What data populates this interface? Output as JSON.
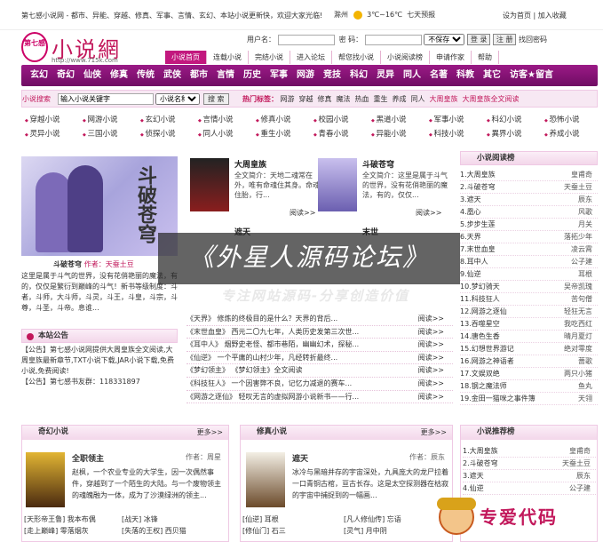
{
  "topbar": {
    "site_desc": "第七感小说网 - 都市、异能、穿越、修真、军事、言情、玄幻、本站小说更新快，欢迎大家光临!",
    "city": "滁州",
    "temp": "3℃~16℃",
    "forecast": "七天预报",
    "set_home": "设为首页",
    "add_fav": "加入收藏"
  },
  "logo": {
    "badge": "第七感",
    "name": "小说網",
    "url": "http://www.715k.com"
  },
  "login": {
    "user_label": "用户名：",
    "pass_label": "密 码：",
    "remember_select": "不保存",
    "login_btn": "登 录",
    "register_btn": "注 册",
    "find_pwd": "找回密码"
  },
  "subnav": [
    "小说首页",
    "连载小说",
    "完结小说",
    "进入论坛",
    "帮您找小说",
    "小说阅读榜",
    "申请作家",
    "帮助"
  ],
  "mainnav": [
    "玄幻",
    "奇幻",
    "仙侠",
    "修真",
    "传统",
    "武侠",
    "都市",
    "言情",
    "历史",
    "军事",
    "网游",
    "竞技",
    "科幻",
    "灵异",
    "同人",
    "名著",
    "科教",
    "其它",
    "访客★留言"
  ],
  "search": {
    "label": "小说搜索",
    "value": "输入小说关键字",
    "type": "小说名称",
    "btn": "搜 索",
    "hot_label": "热门标签：",
    "tags": [
      "网游",
      "穿越",
      "修真",
      "魔法",
      "热血",
      "重生",
      "养成",
      "同人",
      "大周皇族",
      "大周皇族全文阅读"
    ]
  },
  "categories": [
    [
      "穿越小说",
      "网游小说",
      "玄幻小说",
      "言情小说",
      "修真小说",
      "校园小说",
      "黑道小说",
      "军事小说",
      "科幻小说",
      "恐怖小说"
    ],
    [
      "灵异小说",
      "三国小说",
      "侦探小说",
      "同人小说",
      "重生小说",
      "青春小说",
      "异能小说",
      "科技小说",
      "異界小说",
      "养成小说"
    ]
  ],
  "featured": {
    "cover_title": "斗破苍穹",
    "cover_author": "作者：天蚕土豆",
    "title": "斗破苍穹",
    "author": "作者：天蚕土豆",
    "desc": "这里是属于斗气的世界，没有花俏艳丽的魔法，有的，仅仅是繁衍到巅峰的斗气！新书等级制度：斗者，斗师，大斗师，斗灵，斗王，斗皇，斗宗，斗尊，斗圣，斗帝。息谁..."
  },
  "notice": {
    "title": "本站公告",
    "lines": [
      "【公告】第七感小说网提供大周皇族全文阅读,大周皇族最新章节,TXT小说下载,JAR小说下载,免费小说,免费阅读!",
      "【公告】第七感书友群：118331897"
    ]
  },
  "mid_books": [
    {
      "title": "大周皇族",
      "desc": "全文简介：天地二魂常在外，唯有命魂住其身。命魂住胎，行...",
      "more": "阅读>>"
    },
    {
      "title": "斗破苍穹",
      "desc": "全文简介：这里是属于斗气的世界，没有花俏艳丽的魔法，有的，仅仅...",
      "more": "阅读>>"
    },
    {
      "title": "遮天",
      "desc": "",
      "more": ""
    },
    {
      "title": "末世",
      "desc": "",
      "more": ""
    }
  ],
  "mid_list": [
    {
      "t": "《天界》",
      "d": "修炼的终极目的是什么？天界的背后...",
      "r": "阅读>>"
    },
    {
      "t": "《末世血皇》",
      "d": "西元二〇九七年，人类历史发第三次世...",
      "r": "阅读>>"
    },
    {
      "t": "《耳中人》",
      "d": "烟野史老怪、都市巷陌，幽幽幻术，探秘...",
      "r": "阅读>>"
    },
    {
      "t": "《仙逆》",
      "d": "一个平庸的山村少年，凡经转折最终...",
      "r": "阅读>>"
    },
    {
      "t": "《梦幻领主》",
      "d": "《梦幻领主》全文阅读",
      "r": "阅读>>"
    },
    {
      "t": "《科技狂人》",
      "d": "一个因害弊不良，记忆力减退的赛车...",
      "r": "阅读>>"
    },
    {
      "t": "《网游之逐仙》",
      "d": "轻叹无言的虚拟网游小说新书——行...",
      "r": "阅读>>"
    }
  ],
  "rank": {
    "title": "小说阅读榜",
    "items": [
      {
        "n": "1.大周皇族",
        "a": "皇甫奇"
      },
      {
        "n": "2.斗破苍穹",
        "a": "天蚕土豆"
      },
      {
        "n": "3.遮天",
        "a": "辰东"
      },
      {
        "n": "4.凰心",
        "a": "风歌"
      },
      {
        "n": "5.步步生莲",
        "a": "月关"
      },
      {
        "n": "6.天界",
        "a": "落拓少年"
      },
      {
        "n": "7.末世血皇",
        "a": "凌云霄"
      },
      {
        "n": "8.耳中人",
        "a": "公子建"
      },
      {
        "n": "9.仙逆",
        "a": "耳根"
      },
      {
        "n": "10.梦幻骑天",
        "a": "吴帝凯瑰"
      },
      {
        "n": "11.科技狂人",
        "a": "苦句僧"
      },
      {
        "n": "12.网游之逐仙",
        "a": "轻狂无言"
      },
      {
        "n": "13.吞噬星空",
        "a": "我吃西红"
      },
      {
        "n": "14.唐色生香",
        "a": "晴月夏灯"
      },
      {
        "n": "15.幻想世界游记",
        "a": "绝对零度"
      },
      {
        "n": "16.网游之神语者",
        "a": "蔷歌"
      },
      {
        "n": "17.文娱双绝",
        "a": "两只小猪"
      },
      {
        "n": "18.钢之魔法师",
        "a": "鱼丸"
      },
      {
        "n": "19.金田一猫咪之事件簿",
        "a": "天翎"
      }
    ]
  },
  "watermark": {
    "main": "《外星人源码论坛》",
    "sub": "专注网站源码-分享创造价值"
  },
  "sections": [
    {
      "title": "奇幻小说",
      "more": "更多>>",
      "book": {
        "title": "全职领主",
        "author": "作者：周星",
        "desc": "赵枫，一个农业专业的大学生，因一次偶然事件，穿越到了一个陌生的大陆。与一个废物领主的魂魄融为一体，成为了沙漠绿洲的领主..."
      },
      "links": [
        "[天形帝王鲁] 我本布偶",
        "[战天] 冰锋",
        "[走上巅峰] 零落烟灰",
        "[失落的王权] 西贝猫"
      ]
    },
    {
      "title": "修真小说",
      "more": "更多>>",
      "book": {
        "title": "遮天",
        "author": "作者：辰东",
        "desc": "冰冷与黑暗并存的宇宙深处，九具庞大的龙尸拉着一口青铜古棺，亘古长存。这是太空探测器在枯寂的宇宙中捕捉到的一幅画..."
      },
      "links": [
        "[仙逆] 耳根",
        "[凡人修仙传] 忘语",
        "[修仙门] 石三",
        "[灵气] 月中阴"
      ]
    },
    {
      "title": "小说推荐榜",
      "more": "",
      "items": [
        "1.大周皇族",
        "2.斗破苍穹",
        "3.遮天",
        "4.仙逆"
      ],
      "authors": [
        "皇甫奇",
        "天蚕土豆",
        "辰东",
        "公子建"
      ]
    }
  ],
  "stamp": "专爱代码"
}
